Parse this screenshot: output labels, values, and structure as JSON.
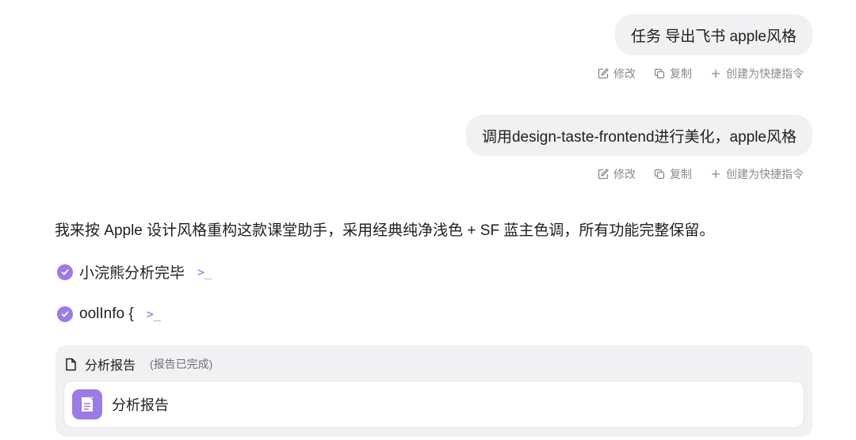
{
  "messages": [
    {
      "text": "任务 导出飞书 apple风格",
      "actions": {
        "edit": "修改",
        "copy": "复制",
        "shortcut": "创建为快捷指令"
      }
    },
    {
      "text": "调用design-taste-frontend进行美化，apple风格",
      "actions": {
        "edit": "修改",
        "copy": "复制",
        "shortcut": "创建为快捷指令"
      }
    }
  ],
  "reply": {
    "text": "我来按 Apple 设计风格重构这款课堂助手，采用经典纯净浅色 + SF 蓝主色调，所有功能完整保留。",
    "steps": [
      {
        "label": "小浣熊分析完毕",
        "terminal": ">_"
      },
      {
        "label": "oolInfo {",
        "terminal": ">_"
      }
    ]
  },
  "report": {
    "title": "分析报告",
    "status": "(报告已完成)",
    "card_title": "分析报告"
  },
  "colors": {
    "accent": "#9b7be8",
    "bubble_bg": "#f1f1f3"
  },
  "icons": [
    "edit-icon",
    "copy-icon",
    "plus-icon",
    "check-icon",
    "terminal-icon",
    "document-icon"
  ]
}
